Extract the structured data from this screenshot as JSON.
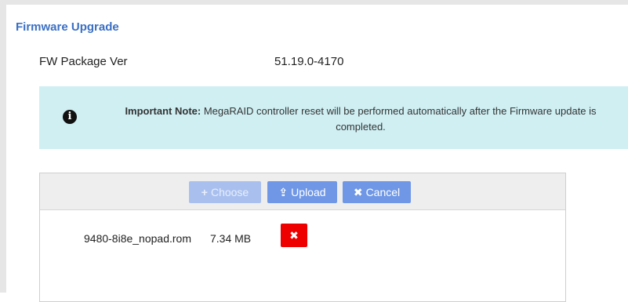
{
  "section": {
    "title": "Firmware Upgrade"
  },
  "info": {
    "label": "FW Package Ver",
    "value": "51.19.0-4170"
  },
  "note": {
    "strong": "Important Note:",
    "text": " MegaRAID controller reset will be performed automatically after the Firmware update is completed.",
    "icon": "info-icon"
  },
  "uploader": {
    "choose_label": "Choose",
    "upload_label": "Upload",
    "cancel_label": "Cancel",
    "file": {
      "name": "9480-8i8e_nopad.rom",
      "size": "7.34 MB"
    }
  },
  "colors": {
    "title": "#3a6fc4",
    "note_bg": "#cfeff3",
    "button": "#6f97e6",
    "remove": "#ee0000"
  }
}
